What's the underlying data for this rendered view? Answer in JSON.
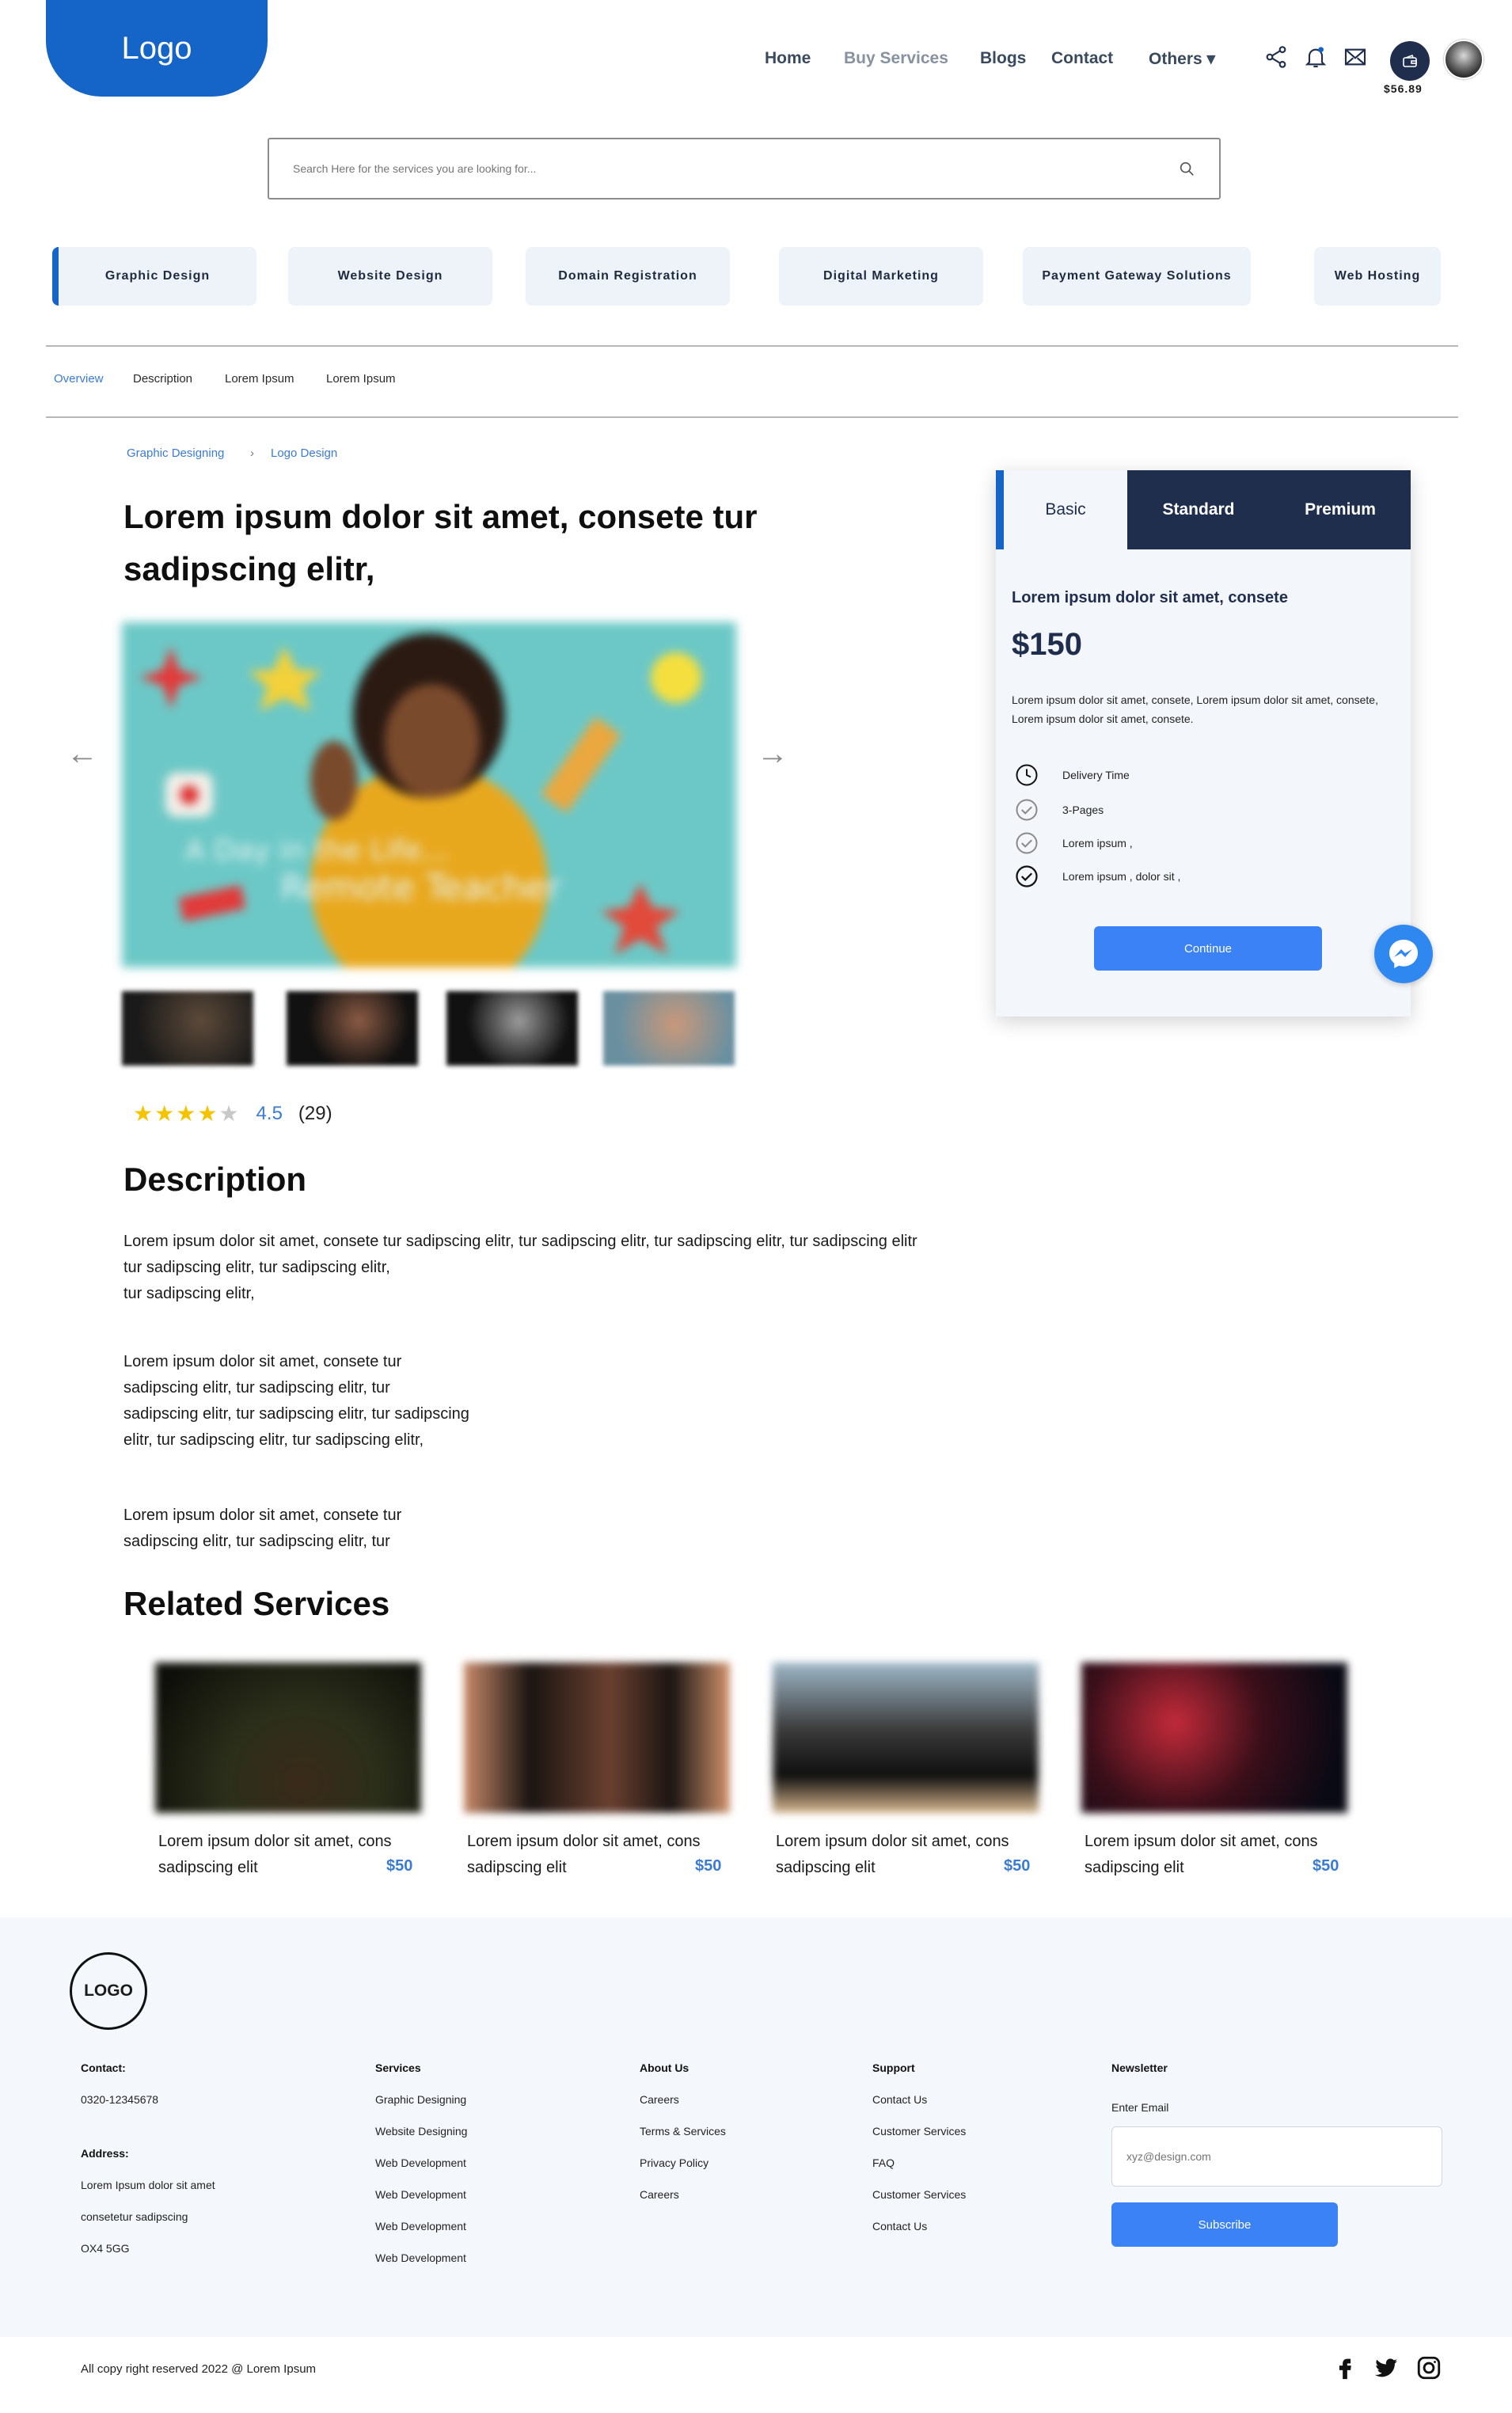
{
  "header": {
    "logo": "Logo",
    "nav": [
      {
        "label": "Home"
      },
      {
        "label": "Buy Services"
      },
      {
        "label": "Blogs"
      },
      {
        "label": "Contact"
      },
      {
        "label": "Others ▾"
      }
    ],
    "wallet_amount": "$56.89",
    "icons": [
      "share-icon",
      "bell-icon",
      "mail-icon",
      "wallet-icon",
      "avatar"
    ]
  },
  "search": {
    "placeholder": "Search Here for the services you are looking for..."
  },
  "categories": [
    "Graphic Design",
    "Website Design",
    "Domain Registration",
    "Digital Marketing",
    "Payment Gateway Solutions",
    "Web Hosting"
  ],
  "subtabs": [
    "Overview",
    "Description",
    "Lorem Ipsum",
    "Lorem Ipsum"
  ],
  "breadcrumb": [
    "Graphic Designing",
    "Logo Design"
  ],
  "product": {
    "title": "Lorem ipsum dolor sit amet, consete tur sadipscing elitr,",
    "hero_caption": "A Day in the Life... Remote Teacher",
    "rating": {
      "value": "4.5",
      "count": "(29)",
      "stars": 4
    }
  },
  "description": {
    "heading": "Description",
    "para1_lines": [
      "Lorem ipsum dolor sit amet, consete tur sadipscing elitr, tur sadipscing elitr, tur sadipscing elitr, tur sadipscing elitr",
      "tur sadipscing elitr, tur sadipscing elitr,",
      "tur sadipscing elitr,"
    ],
    "para2_lines": [
      "Lorem ipsum dolor sit amet, consete tur",
      "sadipscing elitr, tur sadipscing elitr, tur",
      "sadipscing elitr, tur sadipscing elitr, tur sadipscing",
      "elitr, tur sadipscing elitr, tur sadipscing elitr,"
    ],
    "para3_lines": [
      "Lorem ipsum dolor sit amet, consete tur",
      "sadipscing elitr, tur sadipscing elitr, tur"
    ]
  },
  "pricing": {
    "tabs": [
      "Basic",
      "Standard",
      "Premium"
    ],
    "subtitle": "Lorem ipsum dolor sit amet, consete",
    "price": "$150",
    "desc": "Lorem ipsum dolor sit amet, consete, Lorem ipsum dolor sit amet, consete, Lorem ipsum dolor sit amet, consete.",
    "features": [
      "Delivery Time",
      "3-Pages",
      "Lorem ipsum ,",
      "Lorem ipsum , dolor sit ,"
    ],
    "button": "Continue"
  },
  "related": {
    "heading": "Related Services",
    "items": [
      {
        "line1": "Lorem ipsum dolor sit amet, cons",
        "line2": "sadipscing elit",
        "price": "$50"
      },
      {
        "line1": "Lorem ipsum dolor sit amet, cons",
        "line2": "sadipscing elit",
        "price": "$50"
      },
      {
        "line1": "Lorem ipsum dolor sit amet, cons",
        "line2": "sadipscing elit",
        "price": "$50"
      },
      {
        "line1": "Lorem ipsum dolor sit amet, cons",
        "line2": "sadipscing elit",
        "price": "$50"
      }
    ]
  },
  "footer": {
    "logo": "LOGO",
    "contact": {
      "heading": "Contact:",
      "phone": "0320-12345678"
    },
    "address": {
      "heading": "Address:",
      "lines": [
        "Lorem Ipsum dolor sit amet",
        "consetetur sadipscing",
        "OX4 5GG"
      ]
    },
    "services": {
      "heading": "Services",
      "items": [
        "Graphic Designing",
        "Website Designing",
        "Web Development",
        "Web Development",
        "Web Development",
        "Web Development"
      ]
    },
    "about": {
      "heading": "About Us",
      "items": [
        "Careers",
        "Terms & Services",
        "Privacy Policy",
        "Careers"
      ]
    },
    "support": {
      "heading": "Support",
      "items": [
        "Contact Us",
        "Customer Services",
        "FAQ",
        "Customer Services",
        "Contact Us"
      ]
    },
    "newsletter": {
      "heading": "Newsletter",
      "label": "Enter Email",
      "placeholder": "xyz@design.com",
      "button": "Subscribe"
    },
    "copyright": "All copy right reserved 2022 @ Lorem Ipsum",
    "social": [
      "facebook-icon",
      "twitter-icon",
      "instagram-icon"
    ]
  },
  "colors": {
    "brand": "#1565c8",
    "navy": "#1f2e4d",
    "accent": "#3b82f6",
    "star": "#f5c400"
  }
}
